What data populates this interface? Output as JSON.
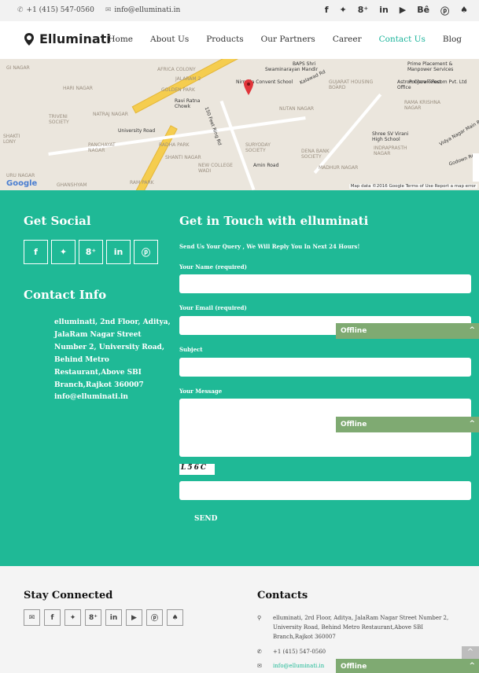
{
  "topbar": {
    "phone": "+1 (415) 547-0560",
    "email": "info@elluminati.in",
    "social": [
      "f",
      "✦",
      "8⁺",
      "in",
      "▶",
      "Bê",
      "ⓟ",
      "♠"
    ]
  },
  "nav": {
    "logo": "Elluminati",
    "items": [
      "Home",
      "About Us",
      "Products",
      "Our Partners",
      "Career",
      "Contact Us",
      "Blog"
    ]
  },
  "map": {
    "labels": [
      "GI NAGAR",
      "AFRICA COLONY",
      "Swaminarayan Mandir",
      "BAPS Shri",
      "Nirmala Convent School",
      "Kalawad Rd",
      "GUJARAT HOUSING BOARD",
      "Astron Chowk Post Office",
      "Poojara Telecom Pvt. Ltd",
      "Prime Placement & Manpower Services",
      "HARI NAGAR",
      "GOLDEN PARK",
      "JALARAM 2",
      "Ravi Ratna Chowk",
      "University Road",
      "NUTAN NAGAR",
      "RAMA KRISHNA NAGAR",
      "TRIVENI SOCIETY",
      "NATRAJ NAGAR",
      "150 Feet Ring Rd",
      "Shree SV Virani High School",
      "Vidya Nagar Main Rd",
      "PANCHAYAT NAGAR",
      "RADHA PARK",
      "SURYODAY SOCIETY",
      "DENA BANK SOCIETY",
      "INDRAPRASTH NAGAR",
      "SHANTI NAGAR",
      "NEW COLLEGE WADI",
      "Amin Road",
      "MADHUR NAGAR",
      "URU NAGAR",
      "GHANSHYAM",
      "RAM PARK",
      "Godown Rd",
      "SHAKTI LONY"
    ],
    "google": "Google",
    "footnote": "Map data ©2016 Google   Terms of Use   Report a map error"
  },
  "contact": {
    "get_social": "Get Social",
    "social_buttons": [
      "f",
      "✦",
      "8⁺",
      "in",
      "ⓟ"
    ],
    "contact_info": "Contact Info",
    "address": "elluminati, 2nd Floor, Aditya, JalaRam Nagar Street Number 2, University Road, Behind Metro Restaurant,Above SBI Branch,Rajkot 360007",
    "email": "info@elluminati.in",
    "form_title": "Get in Touch with elluminati",
    "form_sub": "Send Us Your Query , We Will Reply You In Next 24 Hours!",
    "name_label": "Your Name (required)",
    "email_label": "Your Email (required)",
    "subject_label": "Subject",
    "message_label": "Your Message",
    "captcha": "L56C",
    "send": "SEND"
  },
  "chat": {
    "label": "Offline",
    "chevron": "^"
  },
  "footer": {
    "stay_connected": "Stay Connected",
    "icons": [
      "✉",
      "f",
      "✦",
      "8⁺",
      "in",
      "▶",
      "ⓟ",
      "♠"
    ],
    "contacts_title": "Contacts",
    "address": "elluminati, 2rd Floor, Aditya, JalaRam Nagar Street Number 2, University Road, Behind Metro Restaurant,Above SBI Branch,Rajkot 360007",
    "phone": "+1 (415) 547-0560",
    "email": "info@elluminati.in"
  },
  "colors": {
    "accent": "#1fb996",
    "active_nav": "#19b39a",
    "offline": "#7faa72"
  }
}
